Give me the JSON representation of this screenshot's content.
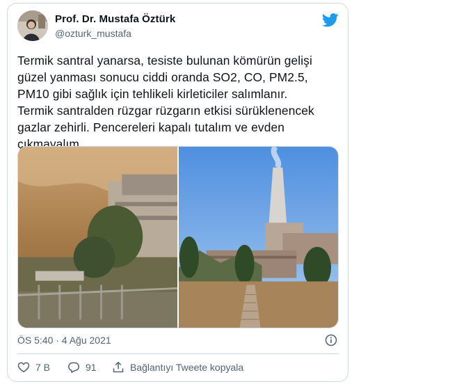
{
  "tweet": {
    "author": {
      "name": "Prof. Dr. Mustafa Öztürk",
      "handle": "@ozturk_mustafa"
    },
    "text": "Termik santral yanarsa, tesiste bulunan kömürün gelişi\ngüzel yanması sonucu ciddi oranda SO2, CO, PM2.5,\nPM10 gibi sağlık için tehlikeli kirleticiler salımlanır.\nTermik santralden rüzgar rüzgarın etkisi sürüklenencek\ngazlar zehirli. Pencereleri kapalı tutalım ve evden\nçıkmayalım",
    "timestamp": "ÖS 5:40 · 4 Ağu 2021",
    "actions": {
      "likes": "7 B",
      "replies": "91",
      "copy_link": "Bağlantıyı Tweete kopyala"
    },
    "icons": {
      "brand": "twitter-bird-icon",
      "info": "info-icon",
      "like": "heart-icon",
      "reply": "reply-icon",
      "share": "upload-icon"
    }
  },
  "colors": {
    "twitter_blue": "#1d9bf0",
    "secondary_text": "#536471",
    "border": "#cfd9de"
  }
}
